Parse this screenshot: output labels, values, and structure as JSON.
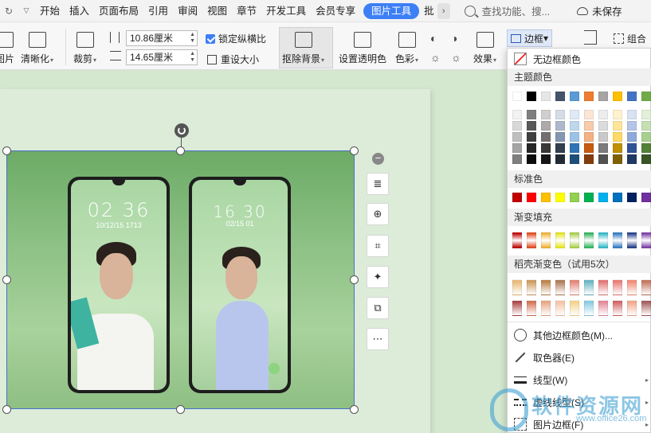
{
  "menubar": {
    "items": [
      "开始",
      "插入",
      "页面布局",
      "引用",
      "审阅",
      "视图",
      "章节",
      "开发工具",
      "会员专享"
    ],
    "active_tab": "图片工具",
    "next_tab": "批",
    "search_placeholder": "查找功能、搜...",
    "save_status": "未保存"
  },
  "ribbon": {
    "left_partial": "图片",
    "sharpen": "清晰化",
    "crop": "裁剪",
    "width_value": "10.86厘米",
    "height_value": "14.65厘米",
    "lock_ratio": "锁定纵横比",
    "reset_size": "重设大小",
    "remove_bg": "抠除背景",
    "set_transparent": "设置透明色",
    "color": "色彩",
    "effect": "效果",
    "border": "边框",
    "group": "组合"
  },
  "phones": [
    {
      "time": "02 36",
      "date": "10/12/15  1713"
    },
    {
      "time": "16 30",
      "date": "02/15 01"
    }
  ],
  "dropdown": {
    "no_border": "无边框颜色",
    "theme_colors_title": "主题颜色",
    "standard_colors_title": "标准色",
    "gradient_fill_title": "渐变填充",
    "premium_gradient_title": "稻壳渐变色（试用5次）",
    "more_colors": "其他边框颜色(M)...",
    "eyedropper": "取色器(E)",
    "line_style": "线型(W)",
    "dash_style": "虚线线型(S)",
    "picture_border": "图片边框(F)",
    "theme_top_row": [
      "#ffffff",
      "#000000",
      "#e7e6e6",
      "#44546a",
      "#5b9bd5",
      "#ed7d31",
      "#a5a5a5",
      "#ffc000",
      "#4472c4",
      "#70ad47"
    ],
    "theme_shades": [
      [
        "#f2f2f2",
        "#7f7f7f",
        "#d0cece",
        "#d6dce4",
        "#deebf6",
        "#fbe5d5",
        "#ededed",
        "#fff2cc",
        "#d9e2f3",
        "#e2efd9"
      ],
      [
        "#d8d8d8",
        "#595959",
        "#aeaaaa",
        "#adb9ca",
        "#bdd7ee",
        "#f7cbac",
        "#dbdbdb",
        "#fee599",
        "#b4c6e7",
        "#c5e0b3"
      ],
      [
        "#bfbfbf",
        "#3f3f3f",
        "#757070",
        "#8496b0",
        "#9cc3e5",
        "#f4b183",
        "#c9c9c9",
        "#ffd965",
        "#8eaadb",
        "#a8d08d"
      ],
      [
        "#a5a5a5",
        "#262626",
        "#3a3838",
        "#323f4f",
        "#2e75b5",
        "#c55a11",
        "#7b7b7b",
        "#bf9000",
        "#2f5496",
        "#538135"
      ],
      [
        "#7f7f7f",
        "#0c0c0c",
        "#171616",
        "#222a35",
        "#1e4e79",
        "#833c0b",
        "#525252",
        "#7f6000",
        "#1f3864",
        "#375623"
      ]
    ],
    "standard_colors": [
      "#c00000",
      "#ff0000",
      "#ffc000",
      "#ffff00",
      "#92d050",
      "#00b050",
      "#00b0f0",
      "#0070c0",
      "#002060",
      "#7030a0"
    ],
    "gradient_colors": [
      "#c00000",
      "#e04a1a",
      "#f2b134",
      "#e6e61a",
      "#a8d04a",
      "#2fb55a",
      "#2fb8c8",
      "#2e7ac0",
      "#1f3c88",
      "#7a3aa8"
    ],
    "premium_row1": [
      "#e8b46a",
      "#c89450",
      "#b7783a",
      "#a9704a",
      "#e07a6a",
      "#5ab0c0",
      "#e06a6a",
      "#e8706a",
      "#f0806a",
      "#c06a50"
    ],
    "premium_row2": [
      "#a83a3a",
      "#d06a4a",
      "#e8a07a",
      "#f4c0a0",
      "#f4d080",
      "#80c8e0",
      "#e08090",
      "#d05a5a",
      "#f0a080",
      "#a05050"
    ]
  },
  "watermark": {
    "text": "软件资源网",
    "url": "www.office26.com"
  }
}
